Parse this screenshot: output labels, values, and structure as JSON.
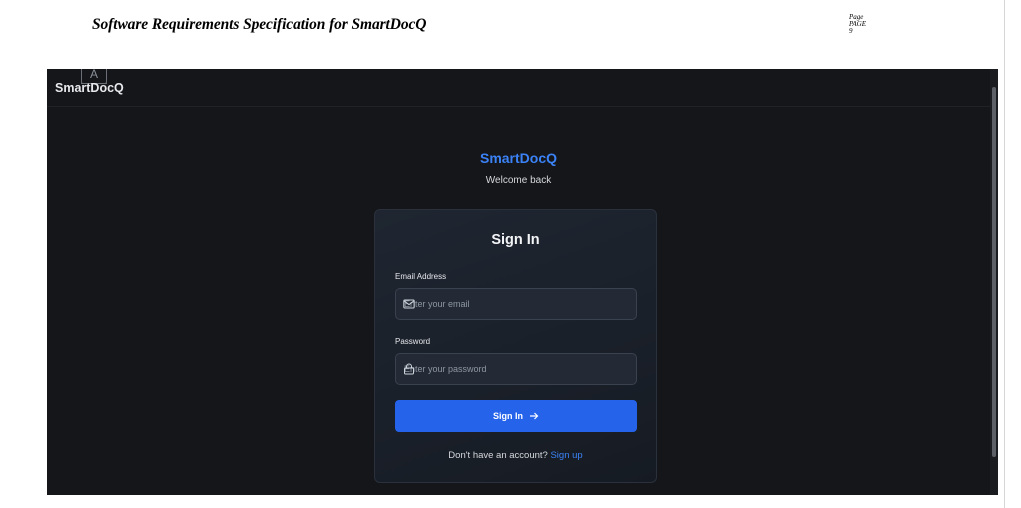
{
  "document": {
    "header_title": "Software Requirements Specification for SmartDocQ",
    "page_field": [
      "Page",
      "PAGE",
      "9"
    ]
  },
  "app": {
    "brand_icon_letter": "A",
    "brand_name": "SmartDocQ",
    "title": "SmartDocQ",
    "subtitle": "Welcome back"
  },
  "signin": {
    "heading": "Sign In",
    "email_label": "Email Address",
    "email_placeholder": "Enter your email",
    "password_label": "Password",
    "password_placeholder": "Enter your password",
    "submit_label": "Sign In",
    "submit_icon": "arrow-right-icon",
    "no_account_text": "Don't have an account?",
    "signup_link": "Sign up"
  },
  "colors": {
    "background": "#141619",
    "accent": "#3b82f6",
    "button": "#2563eb",
    "card": "#1b212b"
  }
}
